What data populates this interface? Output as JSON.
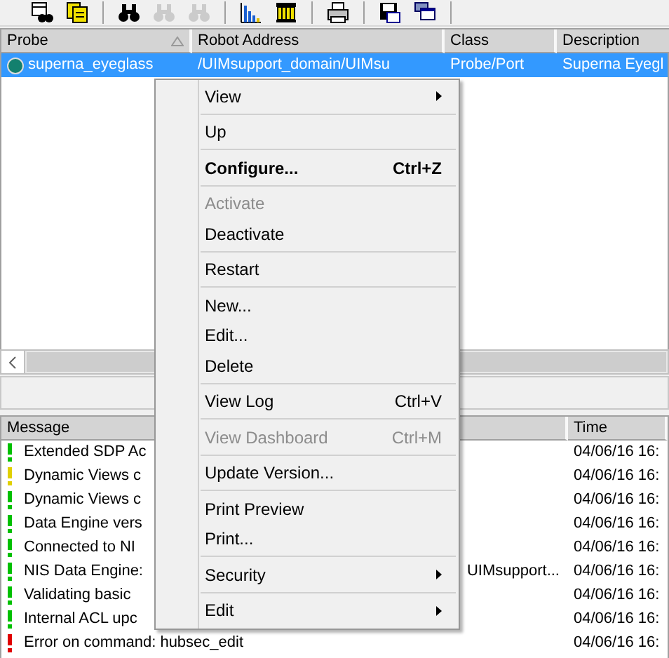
{
  "toolbar": {
    "groups": [
      [
        {
          "kind": "find-table",
          "disabled": false
        },
        {
          "kind": "notes",
          "disabled": false
        }
      ],
      [
        {
          "kind": "binoculars",
          "disabled": false
        },
        {
          "kind": "binoculars",
          "disabled": true
        },
        {
          "kind": "binoculars",
          "disabled": true
        }
      ],
      [
        {
          "kind": "chart",
          "disabled": false
        },
        {
          "kind": "pillar",
          "disabled": false
        }
      ],
      [
        {
          "kind": "printer",
          "disabled": false
        }
      ],
      [
        {
          "kind": "save",
          "disabled": false
        },
        {
          "kind": "windows",
          "disabled": false
        }
      ]
    ]
  },
  "probe_table": {
    "columns": [
      {
        "label": "Probe",
        "sorted": true
      },
      {
        "label": "Robot Address",
        "sorted": false
      },
      {
        "label": "Class",
        "sorted": false
      },
      {
        "label": "Description",
        "sorted": false
      }
    ],
    "rows": [
      {
        "selected": true,
        "color": "#13806e",
        "probe": "superna_eyeglass",
        "robot_address": "/UIMsupport_domain/UIMsu",
        "class": "Probe/Port",
        "description": "Superna Eyegl"
      }
    ]
  },
  "message_table": {
    "columns": [
      {
        "label": "Message"
      },
      {
        "label": "Time"
      }
    ],
    "rows": [
      {
        "color": "#00c000",
        "message": "Extended SDP Ac",
        "time": "04/06/16  16:"
      },
      {
        "color": "#e0d000",
        "message": "Dynamic Views c",
        "time": "04/06/16  16:"
      },
      {
        "color": "#00c000",
        "message": "Dynamic Views c",
        "time": "04/06/16  16:"
      },
      {
        "color": "#00c000",
        "message": "Data Engine vers",
        "time": "04/06/16  16:"
      },
      {
        "color": "#00c000",
        "message": "Connected to NI",
        "time": "04/06/16  16:"
      },
      {
        "color": "#00c000",
        "message": "NIS Data Engine:",
        "message_end": "UIMsupport...",
        "time": "04/06/16  16:"
      },
      {
        "color": "#00c000",
        "message": "Validating basic",
        "time": "04/06/16  16:"
      },
      {
        "color": "#00c000",
        "message": "Internal ACL upc",
        "time": "04/06/16  16:"
      },
      {
        "color": "#e00000",
        "message": "Error on command: hubsec_edit",
        "time": "04/06/16  16:"
      }
    ]
  },
  "context_menu": {
    "items": [
      {
        "kind": "item",
        "label": "View",
        "submenu": true,
        "disabled": false,
        "default": false
      },
      {
        "kind": "separator"
      },
      {
        "kind": "item",
        "label": "Up",
        "disabled": false,
        "default": false
      },
      {
        "kind": "separator"
      },
      {
        "kind": "item",
        "label": "Configure...",
        "shortcut": "Ctrl+Z",
        "disabled": false,
        "default": true
      },
      {
        "kind": "separator"
      },
      {
        "kind": "item",
        "label": "Activate",
        "disabled": true,
        "default": false
      },
      {
        "kind": "item",
        "label": "Deactivate",
        "disabled": false,
        "default": false
      },
      {
        "kind": "separator"
      },
      {
        "kind": "item",
        "label": "Restart",
        "disabled": false,
        "default": false
      },
      {
        "kind": "separator"
      },
      {
        "kind": "item",
        "label": "New...",
        "disabled": false,
        "default": false
      },
      {
        "kind": "item",
        "label": "Edit...",
        "disabled": false,
        "default": false
      },
      {
        "kind": "item",
        "label": "Delete",
        "disabled": false,
        "default": false
      },
      {
        "kind": "separator"
      },
      {
        "kind": "item",
        "label": "View Log",
        "shortcut": "Ctrl+V",
        "disabled": false,
        "default": false
      },
      {
        "kind": "separator"
      },
      {
        "kind": "item",
        "label": "View Dashboard",
        "shortcut": "Ctrl+M",
        "disabled": true,
        "default": false
      },
      {
        "kind": "separator"
      },
      {
        "kind": "item",
        "label": "Update Version...",
        "disabled": false,
        "default": false
      },
      {
        "kind": "separator"
      },
      {
        "kind": "item",
        "label": "Print Preview",
        "disabled": false,
        "default": false
      },
      {
        "kind": "item",
        "label": "Print...",
        "disabled": false,
        "default": false
      },
      {
        "kind": "separator"
      },
      {
        "kind": "item",
        "label": "Security",
        "submenu": true,
        "disabled": false,
        "default": false
      },
      {
        "kind": "separator"
      },
      {
        "kind": "item",
        "label": "Edit",
        "submenu": true,
        "disabled": false,
        "default": false
      }
    ]
  }
}
